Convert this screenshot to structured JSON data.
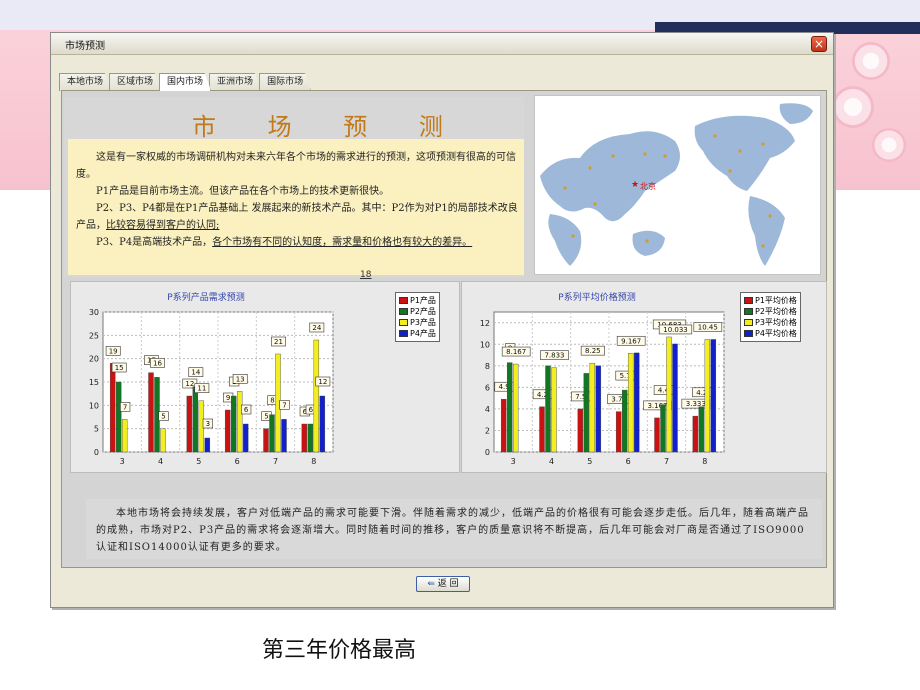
{
  "window": {
    "title": "市场预测",
    "close_glyph": "×"
  },
  "tabs": [
    {
      "label": "本地市场"
    },
    {
      "label": "区域市场"
    },
    {
      "label": "国内市场"
    },
    {
      "label": "亚洲市场"
    },
    {
      "label": "国际市场"
    }
  ],
  "intro": {
    "heading": "市 场 预 测",
    "p1": "这是有一家权威的市场调研机构对未来六年各个市场的需求进行的预测，这项预测有很高的可信度。",
    "p2": "P1产品是目前市场主流。但该产品在各个市场上的技术更新很快。",
    "p3a": "P2、P3、P4都是在P1产品基础上 发展起来的新技术产品。其中：P2作为对P1的局部技术改良产品，",
    "p3b": "比较容易得到客户的认同;",
    "p4a": "P3、P4是高端技术产品，",
    "p4b": "各个市场有不同的认知度，需求量和价格也有较大的差异。",
    "page_number": "18"
  },
  "map": {
    "city_label": "北京",
    "star_glyph": "★"
  },
  "colors": {
    "P1": "#cc1111",
    "P2": "#117722",
    "P3": "#f2ee22",
    "P4": "#1122cc"
  },
  "chart_data": [
    {
      "type": "bar",
      "title": "P系列产品需求预测",
      "categories": [
        "3",
        "4",
        "5",
        "6",
        "7",
        "8"
      ],
      "ylim": [
        0,
        30
      ],
      "yticks": [
        "0",
        "5",
        "10",
        "15",
        "20",
        "25",
        "30"
      ],
      "grid": true,
      "legend_position": "top-right",
      "series": [
        {
          "name": "P1产品",
          "values": [
            19,
            17,
            12,
            9,
            5,
            6
          ],
          "labels": [
            "19",
            "17",
            "12",
            "9",
            "5",
            "6"
          ]
        },
        {
          "name": "P2产品",
          "values": [
            15,
            16,
            14,
            12,
            8,
            6
          ],
          "labels": [
            "15",
            "16",
            "14",
            "1",
            "8",
            "6"
          ]
        },
        {
          "name": "P3产品",
          "values": [
            7,
            5,
            11,
            13,
            21,
            24
          ],
          "labels": [
            "7",
            "5",
            "11",
            "13",
            "21",
            "24"
          ]
        },
        {
          "name": "P4产品",
          "values": [
            0,
            0,
            3,
            6,
            7,
            12
          ],
          "labels": [
            "",
            "",
            "3",
            "6",
            "7",
            "12"
          ]
        }
      ]
    },
    {
      "type": "bar",
      "title": "P系列平均价格预测",
      "categories": [
        "3",
        "4",
        "5",
        "6",
        "7",
        "8"
      ],
      "ylim": [
        0,
        13
      ],
      "yticks": [
        "0",
        "2",
        "4",
        "6",
        "8",
        "10",
        "12"
      ],
      "grid": true,
      "legend_position": "top-right",
      "series": [
        {
          "name": "P1平均价格",
          "values": [
            4.9,
            4.2,
            4.0,
            3.75,
            3.167,
            3.333
          ],
          "labels": [
            "4.9",
            "4.2",
            "7.5",
            "3.75",
            "3.167",
            "3.333"
          ]
        },
        {
          "name": "P2平均价格",
          "values": [
            8.3,
            8.0,
            7.3,
            5.75,
            4.4,
            4.2
          ],
          "labels": [
            "8",
            "",
            "",
            "5.7",
            "4.4",
            "4.2"
          ]
        },
        {
          "name": "P3平均价格",
          "values": [
            8.167,
            7.833,
            8.25,
            9.167,
            10.683,
            10.45
          ],
          "labels": [
            "8.167",
            "7.833",
            "8.25",
            "9.167",
            "10.683",
            "10.45"
          ]
        },
        {
          "name": "P4平均价格",
          "values": [
            0,
            0,
            8.0,
            9.2,
            10.033,
            10.45
          ],
          "labels": [
            "",
            "",
            "",
            "",
            "10.033",
            ""
          ]
        }
      ]
    }
  ],
  "bottom_text": "本地市场将会持续发展，客户对低端产品的需求可能要下滑。伴随着需求的减少，低端产品的价格很有可能会逐步走低。后几年，随着高端产品的成熟，市场对P2、P3产品的需求将会逐渐增大。同时随着时间的推移，客户的质量意识将不断提高，后几年可能会对厂商是否通过了ISO9000认证和ISO14000认证有更多的要求。",
  "return_button": {
    "icon": "return-arrow-icon",
    "label": "返 回"
  },
  "caption": "第三年价格最高"
}
